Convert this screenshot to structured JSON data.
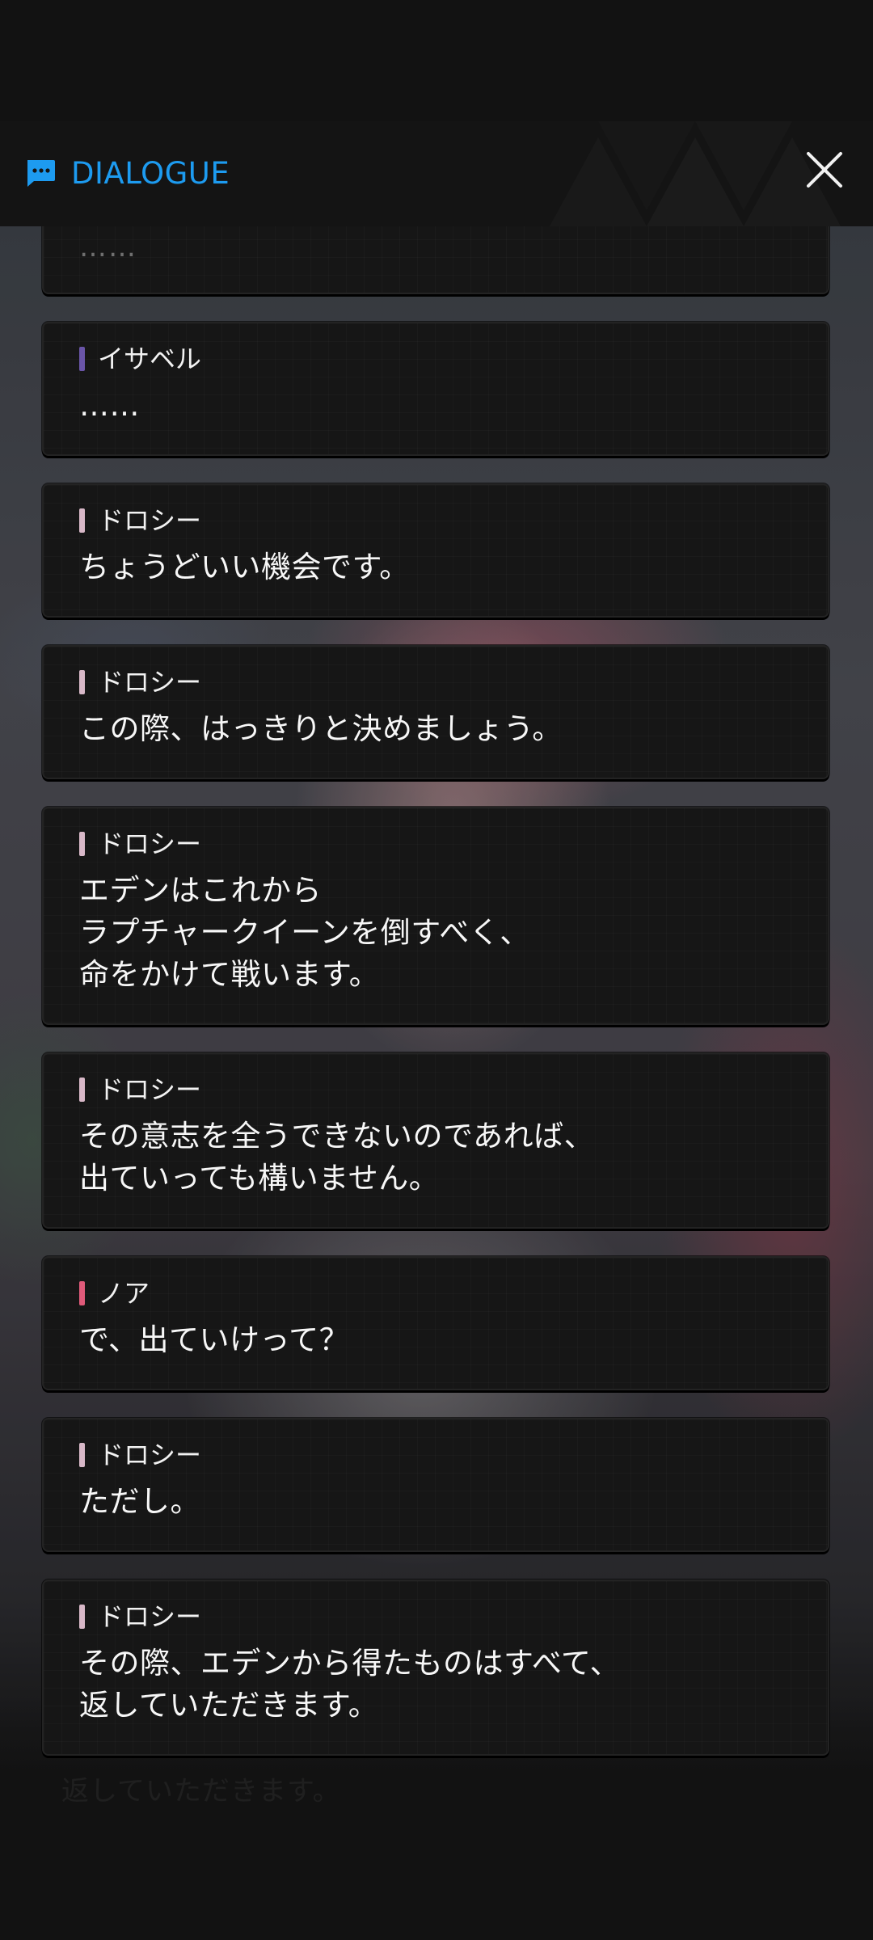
{
  "header": {
    "title": "DIALOGUE",
    "icon": "chat-bubble-icon",
    "accent": "#1d9bf0",
    "close_icon": "close-icon"
  },
  "dialogue": [
    {
      "speaker": "",
      "text": "……",
      "partial": true
    },
    {
      "speaker": "イサベル",
      "speaker_color": "#6a55a8",
      "text": "……"
    },
    {
      "speaker": "ドロシー",
      "speaker_color": "#d8b8c8",
      "text": "ちょうどいい機会です。"
    },
    {
      "speaker": "ドロシー",
      "speaker_color": "#d8b8c8",
      "text": "この際、はっきりと決めましょう。"
    },
    {
      "speaker": "ドロシー",
      "speaker_color": "#d8b8c8",
      "text": "エデンはこれから\nラプチャークイーンを倒すべく、\n命をかけて戦います。"
    },
    {
      "speaker": "ドロシー",
      "speaker_color": "#d8b8c8",
      "text": "その意志を全うできないのであれば、\n出ていっても構いません。"
    },
    {
      "speaker": "ノア",
      "speaker_color": "#e05a7a",
      "text": "で、出ていけって？"
    },
    {
      "speaker": "ドロシー",
      "speaker_color": "#d8b8c8",
      "text": "ただし。"
    },
    {
      "speaker": "ドロシー",
      "speaker_color": "#d8b8c8",
      "text": "その際、エデンから得たものはすべて、\n返していただきます。"
    }
  ],
  "background_caption": "返していただきます。"
}
